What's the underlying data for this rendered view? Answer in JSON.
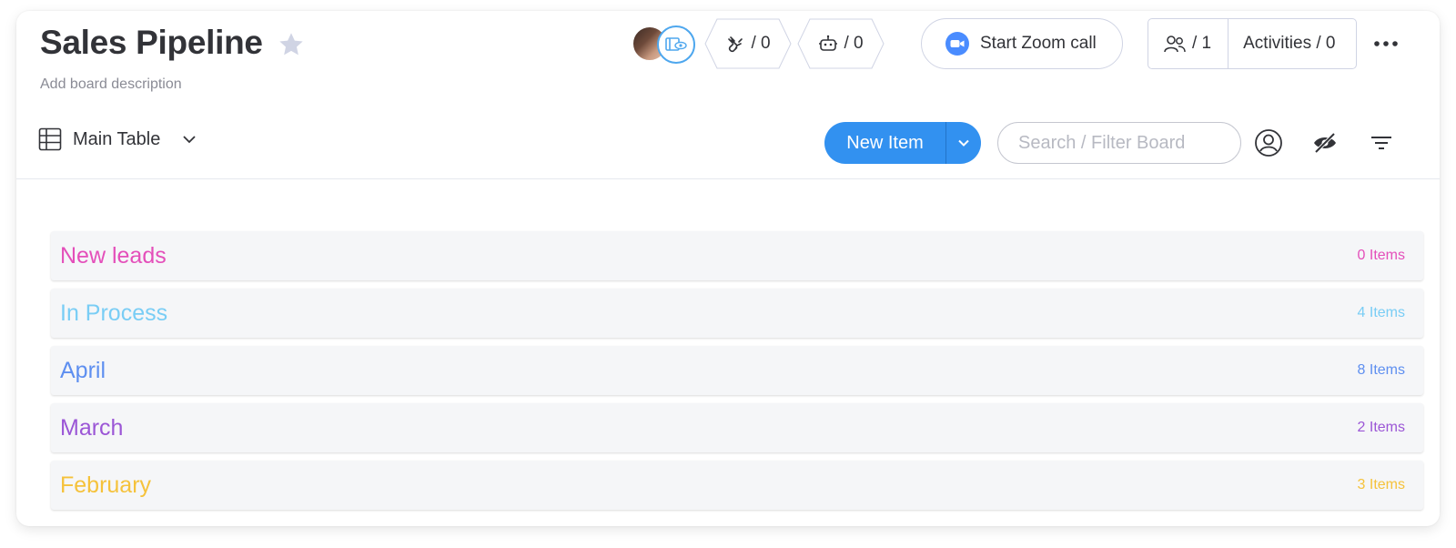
{
  "board": {
    "title": "Sales Pipeline",
    "description": "Add board description"
  },
  "header": {
    "integrations_count": "/ 0",
    "automations_count": "/ 0",
    "zoom_label": "Start Zoom call",
    "members_count": "/ 1",
    "activities_label": "Activities / 0"
  },
  "toolbar": {
    "view_label": "Main Table",
    "new_item_label": "New Item",
    "search_placeholder": "Search / Filter Board"
  },
  "groups": [
    {
      "name": "New leads",
      "count": "0 Items",
      "color": "#e44fba"
    },
    {
      "name": "In Process",
      "count": "4 Items",
      "color": "#79cdf5"
    },
    {
      "name": "April",
      "count": "8 Items",
      "color": "#5e8ff0"
    },
    {
      "name": "March",
      "count": "2 Items",
      "color": "#9b56d6"
    },
    {
      "name": "February",
      "count": "3 Items",
      "color": "#f5c23b"
    }
  ],
  "colors": {
    "primary": "#3291f0",
    "zoom": "#4a8cff",
    "text": "#323338"
  },
  "icons": [
    "star-icon",
    "viewer-icon",
    "integrations-icon",
    "automations-icon",
    "zoom-camera-icon",
    "members-icon",
    "more-icon",
    "table-icon",
    "chevron-down-icon",
    "person-filter-icon",
    "hide-icon",
    "sort-icon"
  ]
}
